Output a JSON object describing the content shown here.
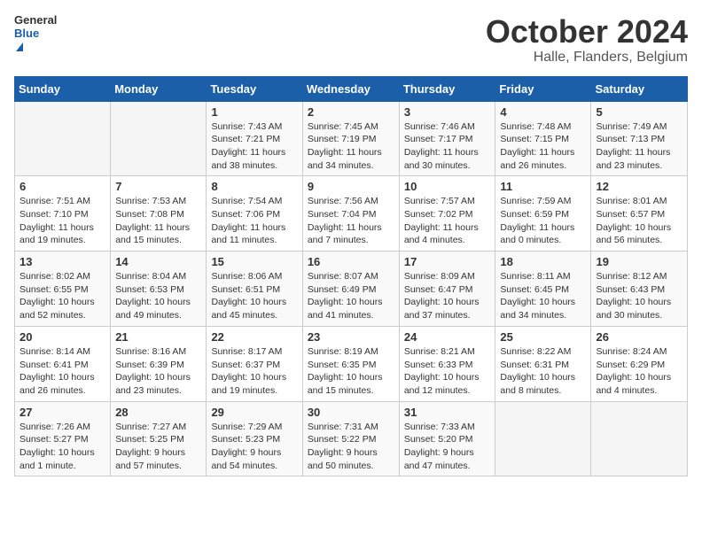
{
  "header": {
    "logo_general": "General",
    "logo_blue": "Blue",
    "title": "October 2024",
    "subtitle": "Halle, Flanders, Belgium"
  },
  "weekdays": [
    "Sunday",
    "Monday",
    "Tuesday",
    "Wednesday",
    "Thursday",
    "Friday",
    "Saturday"
  ],
  "weeks": [
    [
      {
        "day": "",
        "info": ""
      },
      {
        "day": "",
        "info": ""
      },
      {
        "day": "1",
        "info": "Sunrise: 7:43 AM\nSunset: 7:21 PM\nDaylight: 11 hours and 38 minutes."
      },
      {
        "day": "2",
        "info": "Sunrise: 7:45 AM\nSunset: 7:19 PM\nDaylight: 11 hours and 34 minutes."
      },
      {
        "day": "3",
        "info": "Sunrise: 7:46 AM\nSunset: 7:17 PM\nDaylight: 11 hours and 30 minutes."
      },
      {
        "day": "4",
        "info": "Sunrise: 7:48 AM\nSunset: 7:15 PM\nDaylight: 11 hours and 26 minutes."
      },
      {
        "day": "5",
        "info": "Sunrise: 7:49 AM\nSunset: 7:13 PM\nDaylight: 11 hours and 23 minutes."
      }
    ],
    [
      {
        "day": "6",
        "info": "Sunrise: 7:51 AM\nSunset: 7:10 PM\nDaylight: 11 hours and 19 minutes."
      },
      {
        "day": "7",
        "info": "Sunrise: 7:53 AM\nSunset: 7:08 PM\nDaylight: 11 hours and 15 minutes."
      },
      {
        "day": "8",
        "info": "Sunrise: 7:54 AM\nSunset: 7:06 PM\nDaylight: 11 hours and 11 minutes."
      },
      {
        "day": "9",
        "info": "Sunrise: 7:56 AM\nSunset: 7:04 PM\nDaylight: 11 hours and 7 minutes."
      },
      {
        "day": "10",
        "info": "Sunrise: 7:57 AM\nSunset: 7:02 PM\nDaylight: 11 hours and 4 minutes."
      },
      {
        "day": "11",
        "info": "Sunrise: 7:59 AM\nSunset: 6:59 PM\nDaylight: 11 hours and 0 minutes."
      },
      {
        "day": "12",
        "info": "Sunrise: 8:01 AM\nSunset: 6:57 PM\nDaylight: 10 hours and 56 minutes."
      }
    ],
    [
      {
        "day": "13",
        "info": "Sunrise: 8:02 AM\nSunset: 6:55 PM\nDaylight: 10 hours and 52 minutes."
      },
      {
        "day": "14",
        "info": "Sunrise: 8:04 AM\nSunset: 6:53 PM\nDaylight: 10 hours and 49 minutes."
      },
      {
        "day": "15",
        "info": "Sunrise: 8:06 AM\nSunset: 6:51 PM\nDaylight: 10 hours and 45 minutes."
      },
      {
        "day": "16",
        "info": "Sunrise: 8:07 AM\nSunset: 6:49 PM\nDaylight: 10 hours and 41 minutes."
      },
      {
        "day": "17",
        "info": "Sunrise: 8:09 AM\nSunset: 6:47 PM\nDaylight: 10 hours and 37 minutes."
      },
      {
        "day": "18",
        "info": "Sunrise: 8:11 AM\nSunset: 6:45 PM\nDaylight: 10 hours and 34 minutes."
      },
      {
        "day": "19",
        "info": "Sunrise: 8:12 AM\nSunset: 6:43 PM\nDaylight: 10 hours and 30 minutes."
      }
    ],
    [
      {
        "day": "20",
        "info": "Sunrise: 8:14 AM\nSunset: 6:41 PM\nDaylight: 10 hours and 26 minutes."
      },
      {
        "day": "21",
        "info": "Sunrise: 8:16 AM\nSunset: 6:39 PM\nDaylight: 10 hours and 23 minutes."
      },
      {
        "day": "22",
        "info": "Sunrise: 8:17 AM\nSunset: 6:37 PM\nDaylight: 10 hours and 19 minutes."
      },
      {
        "day": "23",
        "info": "Sunrise: 8:19 AM\nSunset: 6:35 PM\nDaylight: 10 hours and 15 minutes."
      },
      {
        "day": "24",
        "info": "Sunrise: 8:21 AM\nSunset: 6:33 PM\nDaylight: 10 hours and 12 minutes."
      },
      {
        "day": "25",
        "info": "Sunrise: 8:22 AM\nSunset: 6:31 PM\nDaylight: 10 hours and 8 minutes."
      },
      {
        "day": "26",
        "info": "Sunrise: 8:24 AM\nSunset: 6:29 PM\nDaylight: 10 hours and 4 minutes."
      }
    ],
    [
      {
        "day": "27",
        "info": "Sunrise: 7:26 AM\nSunset: 5:27 PM\nDaylight: 10 hours and 1 minute."
      },
      {
        "day": "28",
        "info": "Sunrise: 7:27 AM\nSunset: 5:25 PM\nDaylight: 9 hours and 57 minutes."
      },
      {
        "day": "29",
        "info": "Sunrise: 7:29 AM\nSunset: 5:23 PM\nDaylight: 9 hours and 54 minutes."
      },
      {
        "day": "30",
        "info": "Sunrise: 7:31 AM\nSunset: 5:22 PM\nDaylight: 9 hours and 50 minutes."
      },
      {
        "day": "31",
        "info": "Sunrise: 7:33 AM\nSunset: 5:20 PM\nDaylight: 9 hours and 47 minutes."
      },
      {
        "day": "",
        "info": ""
      },
      {
        "day": "",
        "info": ""
      }
    ]
  ]
}
